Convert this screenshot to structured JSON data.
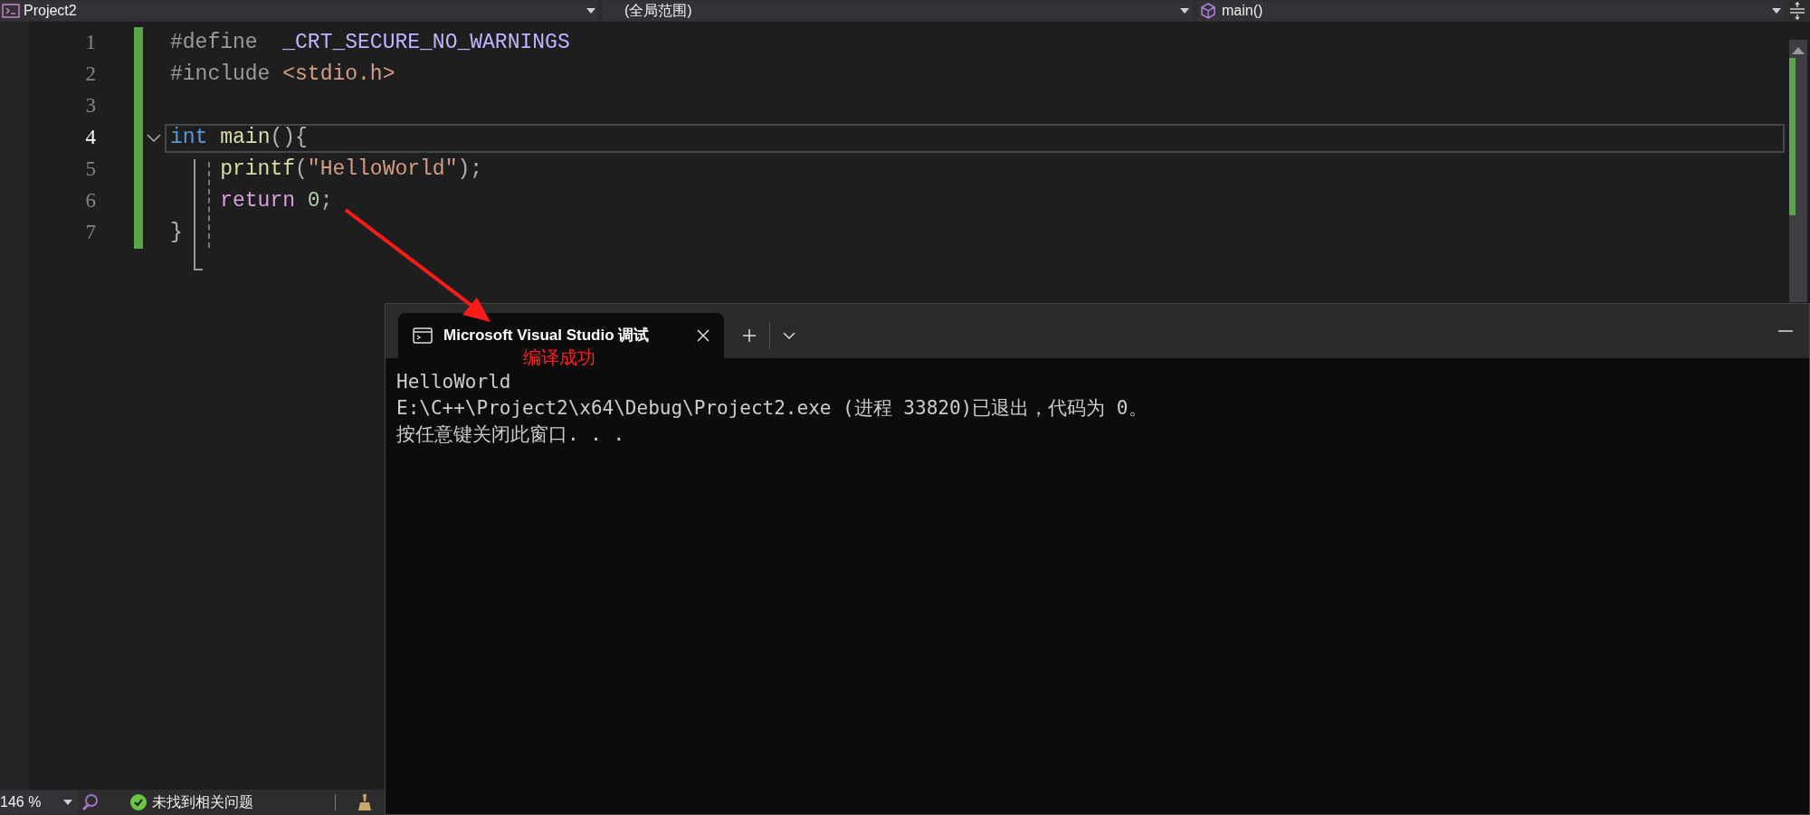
{
  "toolbar": {
    "project": "Project2",
    "scope": "(全局范围)",
    "member": "main()"
  },
  "editor": {
    "lines": [
      {
        "number": "1",
        "current": false,
        "fold": false,
        "tokens": [
          {
            "kind": "directive",
            "text": "#define  "
          },
          {
            "kind": "macro",
            "text": "_CRT_SECURE_NO_WARNINGS"
          }
        ]
      },
      {
        "number": "2",
        "current": false,
        "fold": false,
        "tokens": [
          {
            "kind": "directive",
            "text": "#include "
          },
          {
            "kind": "string",
            "text": "<stdio.h>"
          }
        ]
      },
      {
        "number": "3",
        "current": false,
        "fold": false
      },
      {
        "number": "4",
        "current": true,
        "fold": true,
        "tokens": [
          {
            "kind": "keyword",
            "text": "int"
          },
          {
            "kind": "function",
            "text": " main"
          },
          {
            "kind": "punct",
            "text": "(){"
          }
        ]
      },
      {
        "number": "5",
        "current": false,
        "fold": false,
        "tokens": [
          {
            "kind": "function",
            "text": "    printf"
          },
          {
            "kind": "punct",
            "text": "("
          },
          {
            "kind": "string",
            "text": "\"HelloWorld\""
          },
          {
            "kind": "punct",
            "text": ");"
          }
        ]
      },
      {
        "number": "6",
        "current": false,
        "fold": false,
        "tokens": [
          {
            "kind": "control",
            "text": "    return"
          },
          {
            "kind": "number",
            "text": " 0"
          },
          {
            "kind": "punct",
            "text": ";"
          }
        ]
      },
      {
        "number": "7",
        "current": false,
        "fold": false,
        "tokens": [
          {
            "kind": "punct",
            "text": "}"
          }
        ]
      }
    ]
  },
  "terminal": {
    "tab": {
      "title": "Microsoft Visual Studio 调试"
    },
    "output": [
      "HelloWorld",
      "E:\\C++\\Project2\\x64\\Debug\\Project2.exe (进程 33820)已退出，代码为 0。",
      "按任意键关闭此窗口. . ."
    ]
  },
  "annotation": {
    "label": "编译成功"
  },
  "status_bar": {
    "zoom": "146 %",
    "issues": "未找到相关问题"
  }
}
